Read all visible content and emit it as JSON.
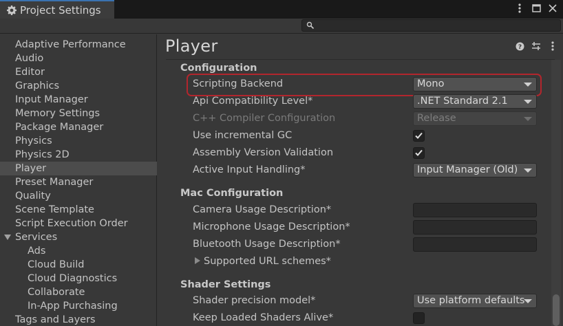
{
  "window": {
    "tab_title": "Project Settings",
    "tab_icon": "gear-icon"
  },
  "search": {
    "placeholder": "",
    "value": ""
  },
  "sidebar": {
    "items": [
      {
        "label": "Adaptive Performance"
      },
      {
        "label": "Audio"
      },
      {
        "label": "Editor"
      },
      {
        "label": "Graphics"
      },
      {
        "label": "Input Manager"
      },
      {
        "label": "Memory Settings"
      },
      {
        "label": "Package Manager"
      },
      {
        "label": "Physics"
      },
      {
        "label": "Physics 2D"
      },
      {
        "label": "Player"
      },
      {
        "label": "Preset Manager"
      },
      {
        "label": "Quality"
      },
      {
        "label": "Scene Template"
      },
      {
        "label": "Script Execution Order"
      },
      {
        "label": "Services"
      },
      {
        "label": "Ads"
      },
      {
        "label": "Cloud Build"
      },
      {
        "label": "Cloud Diagnostics"
      },
      {
        "label": "Collaborate"
      },
      {
        "label": "In-App Purchasing"
      },
      {
        "label": "Tags and Layers"
      }
    ],
    "selected": "Player"
  },
  "main": {
    "title": "Player",
    "sections": {
      "configuration": {
        "heading": "Configuration",
        "scripting_backend": {
          "label": "Scripting Backend",
          "value": "Mono"
        },
        "api_compat": {
          "label": "Api Compatibility Level*",
          "value": ".NET Standard 2.1"
        },
        "cpp_compiler": {
          "label": "C++ Compiler Configuration",
          "value": "Release"
        },
        "incremental_gc": {
          "label": "Use incremental GC",
          "checked": true
        },
        "assembly_validation": {
          "label": "Assembly Version Validation",
          "checked": true
        },
        "active_input": {
          "label": "Active Input Handling*",
          "value": "Input Manager (Old)"
        }
      },
      "mac": {
        "heading": "Mac Configuration",
        "camera_usage": {
          "label": "Camera Usage Description*",
          "value": ""
        },
        "microphone_usage": {
          "label": "Microphone Usage Description*",
          "value": ""
        },
        "bluetooth_usage": {
          "label": "Bluetooth Usage Description*",
          "value": ""
        },
        "url_schemes": {
          "label": "Supported URL schemes*"
        }
      },
      "shader": {
        "heading": "Shader Settings",
        "precision_model": {
          "label": "Shader precision model*",
          "value": "Use platform defaults"
        },
        "keep_loaded": {
          "label": "Keep Loaded Shaders Alive*",
          "checked": false
        }
      }
    }
  },
  "colors": {
    "highlight": "#b3262d",
    "accent": "#3a72b0"
  }
}
